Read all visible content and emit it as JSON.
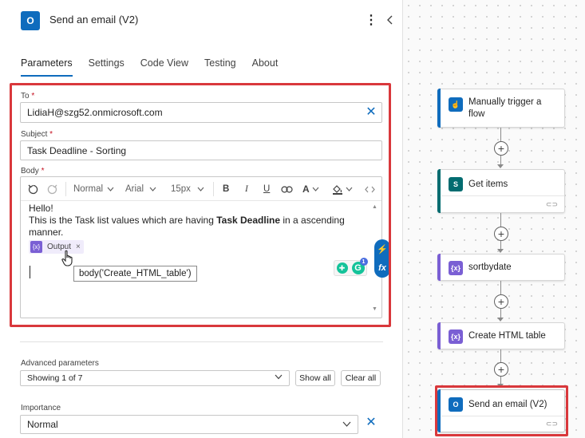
{
  "header": {
    "title": "Send an email (V2)",
    "icon": "outlook-icon",
    "icon_text": "O"
  },
  "tabs": [
    {
      "label": "Parameters",
      "active": true
    },
    {
      "label": "Settings",
      "active": false
    },
    {
      "label": "Code View",
      "active": false
    },
    {
      "label": "Testing",
      "active": false
    },
    {
      "label": "About",
      "active": false
    }
  ],
  "to": {
    "label": "To",
    "required": "*",
    "value": "LidiaH@szg52.onmicrosoft.com"
  },
  "subject": {
    "label": "Subject",
    "required": "*",
    "value": "Task Deadline  - Sorting"
  },
  "body": {
    "label": "Body",
    "required": "*",
    "toolbar": {
      "format": "Normal",
      "font": "Arial",
      "size": "15px",
      "bold": "B",
      "italic": "I",
      "underline": "U",
      "font_color": "A"
    },
    "line1": "Hello!",
    "line2_pre": "This is the Task list values which are having ",
    "line2_bold": "Task Deadline",
    "line2_post": " in a ascending manner.",
    "token_label": "Output",
    "token_close": "×",
    "tooltip": "body('Create_HTML_table')"
  },
  "ai_bar": {
    "top": "⚡",
    "bottom": "fx"
  },
  "grammarly": {
    "badge": "1",
    "letter": "G"
  },
  "advanced": {
    "label": "Advanced parameters",
    "value": "Showing 1 of 7",
    "show_all": "Show all",
    "clear_all": "Clear all"
  },
  "importance": {
    "label": "Importance",
    "value": "Normal"
  },
  "flow": {
    "nodes": [
      {
        "title": "Manually trigger a flow",
        "color": "#0f6cbd",
        "icon": "hand-icon"
      },
      {
        "title": "Get items",
        "color": "#036c70",
        "icon": "sharepoint-icon"
      },
      {
        "title": "sortbydate",
        "color": "#7a5fd4",
        "icon": "compose-icon"
      },
      {
        "title": "Create HTML table",
        "color": "#7a5fd4",
        "icon": "data-operation-icon"
      },
      {
        "title": "Send an email (V2)",
        "color": "#0f6cbd",
        "icon": "outlook-icon"
      }
    ]
  },
  "colors": {
    "accent": "#0f6cbd",
    "highlight": "#d9383c",
    "expression": "#7a5fd4"
  }
}
